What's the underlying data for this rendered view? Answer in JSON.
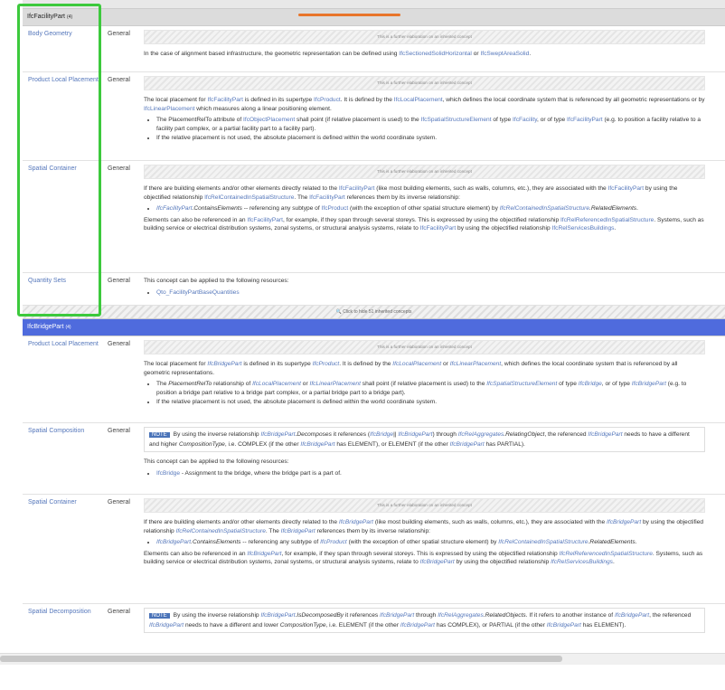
{
  "facility": {
    "title": "IfcFacilityPart",
    "count": "(4)",
    "rows": {
      "body": {
        "name": "Body Geometry",
        "type": "General"
      },
      "placement": {
        "name": "Product Local Placement",
        "type": "General"
      },
      "container": {
        "name": "Spatial Container",
        "type": "General"
      },
      "qsets": {
        "name": "Quantity Sets",
        "type": "General"
      }
    },
    "qsets_text": "This concept can be applied to the following resources:",
    "qsets_item": "Qto_FacilityPartBaseQuantities"
  },
  "inherited_label": "This is a further elaboration on an inherited concept",
  "toggle_label": "🔍 Click to hide 51 inherited concepts",
  "bridge": {
    "title": "IfcBridgePart",
    "count": "(4)",
    "rows": {
      "placement": {
        "name": "Product Local Placement",
        "type": "General"
      },
      "composition": {
        "name": "Spatial Composition",
        "type": "General"
      },
      "container": {
        "name": "Spatial Container",
        "type": "General"
      },
      "decomposition": {
        "name": "Spatial Decomposition",
        "type": "General"
      }
    },
    "note_tag": "NOTE",
    "comp_text": "This concept can be applied to the following resources:",
    "comp_item": "IfcBridge",
    "comp_item_desc": " - Assignment to the bridge, where the bridge part is a part of."
  }
}
